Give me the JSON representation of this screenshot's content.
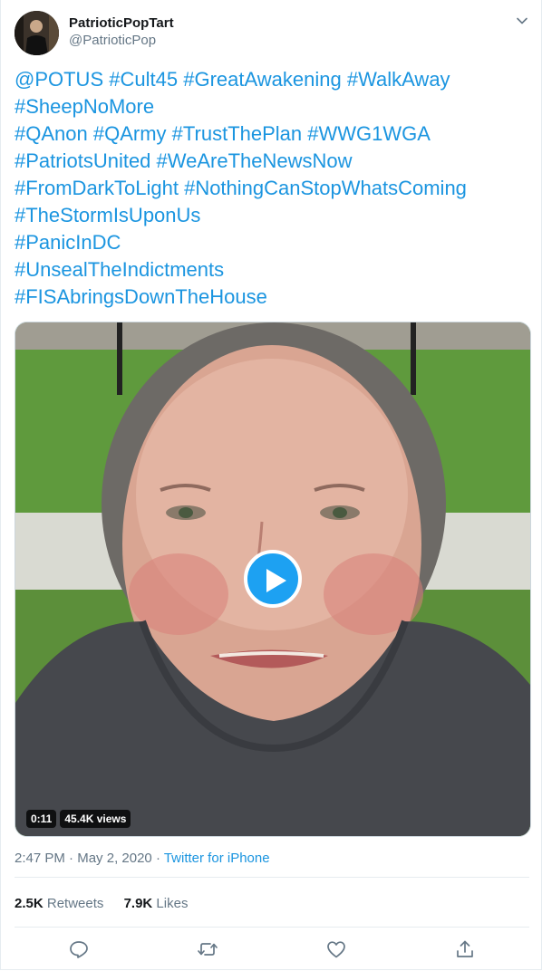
{
  "author": {
    "display_name": "PatrioticPopTart",
    "handle": "@PatrioticPop"
  },
  "tweet": {
    "lines": [
      [
        "@POTUS",
        "#Cult45",
        "#GreatAwakening",
        "#WalkAway"
      ],
      [
        "#SheepNoMore"
      ],
      [
        "#QAnon",
        "#QArmy",
        "#TrustThePlan",
        "#WWG1WGA"
      ],
      [
        "#PatriotsUnited",
        "#WeAreTheNewsNow"
      ],
      [
        "#FromDarkToLight",
        "#NothingCanStopWhatsComing"
      ],
      [
        "#TheStormIsUponUs"
      ],
      [
        "#PanicInDC"
      ],
      [
        "#UnsealTheIndictments"
      ],
      [
        "#FISAbringsDownTheHouse"
      ]
    ]
  },
  "media": {
    "duration": "0:11",
    "views": "45.4K views"
  },
  "meta": {
    "time": "2:47 PM",
    "separator": " · ",
    "date": "May 2, 2020",
    "source": "Twitter for iPhone"
  },
  "stats": {
    "retweets_count": "2.5K",
    "retweets_label": "Retweets",
    "likes_count": "7.9K",
    "likes_label": "Likes"
  },
  "colors": {
    "link": "#1b95e0",
    "play": "#1da1f2",
    "muted": "#657786"
  },
  "icons": {
    "caret": "chevron-down-icon",
    "reply": "reply-icon",
    "retweet": "retweet-icon",
    "like": "heart-icon",
    "share": "share-icon"
  }
}
